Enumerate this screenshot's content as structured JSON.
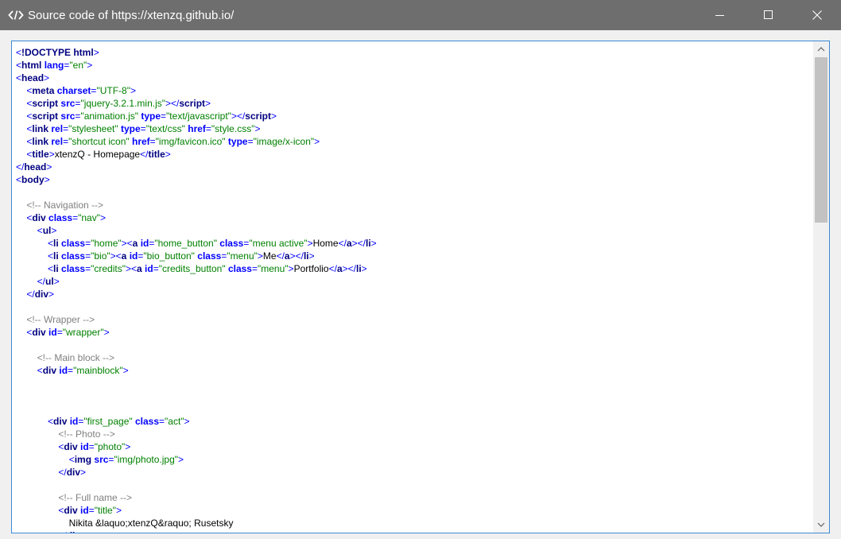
{
  "window": {
    "title": "Source code of https://xtenzq.github.io/",
    "app_icon": "code-brackets-icon",
    "controls": {
      "minimize": "minimize-icon",
      "maximize": "maximize-icon",
      "close": "close-icon"
    }
  },
  "colors": {
    "titlebar": "#6e6e6e",
    "tag": "#000080",
    "attribute": "#0000ff",
    "value": "#008000",
    "comment": "#808080",
    "border_accent": "#3c8ad6"
  },
  "source": {
    "lines": [
      [
        [
          "b",
          "<"
        ],
        [
          "t",
          "!DOCTYPE html"
        ],
        [
          "b",
          ">"
        ]
      ],
      [
        [
          "b",
          "<"
        ],
        [
          "t",
          "html"
        ],
        [
          "x",
          " "
        ],
        [
          "a",
          "lang"
        ],
        [
          "e",
          "="
        ],
        [
          "v",
          "\"en\""
        ],
        [
          "b",
          ">"
        ]
      ],
      [
        [
          "b",
          "<"
        ],
        [
          "t",
          "head"
        ],
        [
          "b",
          ">"
        ]
      ],
      [
        [
          "x",
          "    "
        ],
        [
          "b",
          "<"
        ],
        [
          "t",
          "meta"
        ],
        [
          "x",
          " "
        ],
        [
          "a",
          "charset"
        ],
        [
          "e",
          "="
        ],
        [
          "v",
          "\"UTF-8\""
        ],
        [
          "b",
          ">"
        ]
      ],
      [
        [
          "x",
          "    "
        ],
        [
          "b",
          "<"
        ],
        [
          "t",
          "script"
        ],
        [
          "x",
          " "
        ],
        [
          "a",
          "src"
        ],
        [
          "e",
          "="
        ],
        [
          "v",
          "\"jquery-3.2.1.min.js\""
        ],
        [
          "b",
          "></"
        ],
        [
          "t",
          "script"
        ],
        [
          "b",
          ">"
        ]
      ],
      [
        [
          "x",
          "    "
        ],
        [
          "b",
          "<"
        ],
        [
          "t",
          "script"
        ],
        [
          "x",
          " "
        ],
        [
          "a",
          "src"
        ],
        [
          "e",
          "="
        ],
        [
          "v",
          "\"animation.js\""
        ],
        [
          "x",
          " "
        ],
        [
          "a",
          "type"
        ],
        [
          "e",
          "="
        ],
        [
          "v",
          "\"text/javascript\""
        ],
        [
          "b",
          "></"
        ],
        [
          "t",
          "script"
        ],
        [
          "b",
          ">"
        ]
      ],
      [
        [
          "x",
          "    "
        ],
        [
          "b",
          "<"
        ],
        [
          "t",
          "link"
        ],
        [
          "x",
          " "
        ],
        [
          "a",
          "rel"
        ],
        [
          "e",
          "="
        ],
        [
          "v",
          "\"stylesheet\""
        ],
        [
          "x",
          " "
        ],
        [
          "a",
          "type"
        ],
        [
          "e",
          "="
        ],
        [
          "v",
          "\"text/css\""
        ],
        [
          "x",
          " "
        ],
        [
          "a",
          "href"
        ],
        [
          "e",
          "="
        ],
        [
          "v",
          "\"style.css\""
        ],
        [
          "b",
          ">"
        ]
      ],
      [
        [
          "x",
          "    "
        ],
        [
          "b",
          "<"
        ],
        [
          "t",
          "link"
        ],
        [
          "x",
          " "
        ],
        [
          "a",
          "rel"
        ],
        [
          "e",
          "="
        ],
        [
          "v",
          "\"shortcut icon\""
        ],
        [
          "x",
          " "
        ],
        [
          "a",
          "href"
        ],
        [
          "e",
          "="
        ],
        [
          "v",
          "\"img/favicon.ico\""
        ],
        [
          "x",
          " "
        ],
        [
          "a",
          "type"
        ],
        [
          "e",
          "="
        ],
        [
          "v",
          "\"image/x-icon\""
        ],
        [
          "b",
          ">"
        ]
      ],
      [
        [
          "x",
          "    "
        ],
        [
          "b",
          "<"
        ],
        [
          "t",
          "title"
        ],
        [
          "b",
          ">"
        ],
        [
          "x",
          "xtenzQ - Homepage"
        ],
        [
          "b",
          "</"
        ],
        [
          "t",
          "title"
        ],
        [
          "b",
          ">"
        ]
      ],
      [
        [
          "b",
          "</"
        ],
        [
          "t",
          "head"
        ],
        [
          "b",
          ">"
        ]
      ],
      [
        [
          "b",
          "<"
        ],
        [
          "t",
          "body"
        ],
        [
          "b",
          ">"
        ]
      ],
      [],
      [
        [
          "x",
          "    "
        ],
        [
          "c",
          "<!-- Navigation -->"
        ]
      ],
      [
        [
          "x",
          "    "
        ],
        [
          "b",
          "<"
        ],
        [
          "t",
          "div"
        ],
        [
          "x",
          " "
        ],
        [
          "a",
          "class"
        ],
        [
          "e",
          "="
        ],
        [
          "v",
          "\"nav\""
        ],
        [
          "b",
          ">"
        ]
      ],
      [
        [
          "x",
          "        "
        ],
        [
          "b",
          "<"
        ],
        [
          "t",
          "ul"
        ],
        [
          "b",
          ">"
        ]
      ],
      [
        [
          "x",
          "            "
        ],
        [
          "b",
          "<"
        ],
        [
          "t",
          "li"
        ],
        [
          "x",
          " "
        ],
        [
          "a",
          "class"
        ],
        [
          "e",
          "="
        ],
        [
          "v",
          "\"home\""
        ],
        [
          "b",
          "><"
        ],
        [
          "t",
          "a"
        ],
        [
          "x",
          " "
        ],
        [
          "a",
          "id"
        ],
        [
          "e",
          "="
        ],
        [
          "v",
          "\"home_button\""
        ],
        [
          "x",
          " "
        ],
        [
          "a",
          "class"
        ],
        [
          "e",
          "="
        ],
        [
          "v",
          "\"menu active\""
        ],
        [
          "b",
          ">"
        ],
        [
          "x",
          "Home"
        ],
        [
          "b",
          "</"
        ],
        [
          "t",
          "a"
        ],
        [
          "b",
          "></"
        ],
        [
          "t",
          "li"
        ],
        [
          "b",
          ">"
        ]
      ],
      [
        [
          "x",
          "            "
        ],
        [
          "b",
          "<"
        ],
        [
          "t",
          "li"
        ],
        [
          "x",
          " "
        ],
        [
          "a",
          "class"
        ],
        [
          "e",
          "="
        ],
        [
          "v",
          "\"bio\""
        ],
        [
          "b",
          "><"
        ],
        [
          "t",
          "a"
        ],
        [
          "x",
          " "
        ],
        [
          "a",
          "id"
        ],
        [
          "e",
          "="
        ],
        [
          "v",
          "\"bio_button\""
        ],
        [
          "x",
          " "
        ],
        [
          "a",
          "class"
        ],
        [
          "e",
          "="
        ],
        [
          "v",
          "\"menu\""
        ],
        [
          "b",
          ">"
        ],
        [
          "x",
          "Me"
        ],
        [
          "b",
          "</"
        ],
        [
          "t",
          "a"
        ],
        [
          "b",
          "></"
        ],
        [
          "t",
          "li"
        ],
        [
          "b",
          ">"
        ]
      ],
      [
        [
          "x",
          "            "
        ],
        [
          "b",
          "<"
        ],
        [
          "t",
          "li"
        ],
        [
          "x",
          " "
        ],
        [
          "a",
          "class"
        ],
        [
          "e",
          "="
        ],
        [
          "v",
          "\"credits\""
        ],
        [
          "b",
          "><"
        ],
        [
          "t",
          "a"
        ],
        [
          "x",
          " "
        ],
        [
          "a",
          "id"
        ],
        [
          "e",
          "="
        ],
        [
          "v",
          "\"credits_button\""
        ],
        [
          "x",
          " "
        ],
        [
          "a",
          "class"
        ],
        [
          "e",
          "="
        ],
        [
          "v",
          "\"menu\""
        ],
        [
          "b",
          ">"
        ],
        [
          "x",
          "Portfolio"
        ],
        [
          "b",
          "</"
        ],
        [
          "t",
          "a"
        ],
        [
          "b",
          "></"
        ],
        [
          "t",
          "li"
        ],
        [
          "b",
          ">"
        ]
      ],
      [
        [
          "x",
          "        "
        ],
        [
          "b",
          "</"
        ],
        [
          "t",
          "ul"
        ],
        [
          "b",
          ">"
        ]
      ],
      [
        [
          "x",
          "    "
        ],
        [
          "b",
          "</"
        ],
        [
          "t",
          "div"
        ],
        [
          "b",
          ">"
        ]
      ],
      [],
      [
        [
          "x",
          "    "
        ],
        [
          "c",
          "<!-- Wrapper -->"
        ]
      ],
      [
        [
          "x",
          "    "
        ],
        [
          "b",
          "<"
        ],
        [
          "t",
          "div"
        ],
        [
          "x",
          " "
        ],
        [
          "a",
          "id"
        ],
        [
          "e",
          "="
        ],
        [
          "v",
          "\"wrapper\""
        ],
        [
          "b",
          ">"
        ]
      ],
      [],
      [
        [
          "x",
          "        "
        ],
        [
          "c",
          "<!-- Main block -->"
        ]
      ],
      [
        [
          "x",
          "        "
        ],
        [
          "b",
          "<"
        ],
        [
          "t",
          "div"
        ],
        [
          "x",
          " "
        ],
        [
          "a",
          "id"
        ],
        [
          "e",
          "="
        ],
        [
          "v",
          "\"mainblock\""
        ],
        [
          "b",
          ">"
        ]
      ],
      [],
      [],
      [],
      [
        [
          "x",
          "            "
        ],
        [
          "b",
          "<"
        ],
        [
          "t",
          "div"
        ],
        [
          "x",
          " "
        ],
        [
          "a",
          "id"
        ],
        [
          "e",
          "="
        ],
        [
          "v",
          "\"first_page\""
        ],
        [
          "x",
          " "
        ],
        [
          "a",
          "class"
        ],
        [
          "e",
          "="
        ],
        [
          "v",
          "\"act\""
        ],
        [
          "b",
          ">"
        ]
      ],
      [
        [
          "x",
          "                "
        ],
        [
          "c",
          "<!-- Photo -->"
        ]
      ],
      [
        [
          "x",
          "                "
        ],
        [
          "b",
          "<"
        ],
        [
          "t",
          "div"
        ],
        [
          "x",
          " "
        ],
        [
          "a",
          "id"
        ],
        [
          "e",
          "="
        ],
        [
          "v",
          "\"photo\""
        ],
        [
          "b",
          ">"
        ]
      ],
      [
        [
          "x",
          "                    "
        ],
        [
          "b",
          "<"
        ],
        [
          "t",
          "img"
        ],
        [
          "x",
          " "
        ],
        [
          "a",
          "src"
        ],
        [
          "e",
          "="
        ],
        [
          "v",
          "\"img/photo.jpg\""
        ],
        [
          "b",
          ">"
        ]
      ],
      [
        [
          "x",
          "                "
        ],
        [
          "b",
          "</"
        ],
        [
          "t",
          "div"
        ],
        [
          "b",
          ">"
        ]
      ],
      [],
      [
        [
          "x",
          "                "
        ],
        [
          "c",
          "<!-- Full name -->"
        ]
      ],
      [
        [
          "x",
          "                "
        ],
        [
          "b",
          "<"
        ],
        [
          "t",
          "div"
        ],
        [
          "x",
          " "
        ],
        [
          "a",
          "id"
        ],
        [
          "e",
          "="
        ],
        [
          "v",
          "\"title\""
        ],
        [
          "b",
          ">"
        ]
      ],
      [
        [
          "x",
          "                    Nikita &laquo;xtenzQ&raquo; Rusetsky"
        ]
      ],
      [
        [
          "x",
          "                "
        ],
        [
          "b",
          "</"
        ],
        [
          "t",
          "div"
        ],
        [
          "b",
          ">"
        ]
      ]
    ]
  },
  "scrollbar": {
    "position_fraction": 0.0,
    "visible_fraction": 0.36
  }
}
